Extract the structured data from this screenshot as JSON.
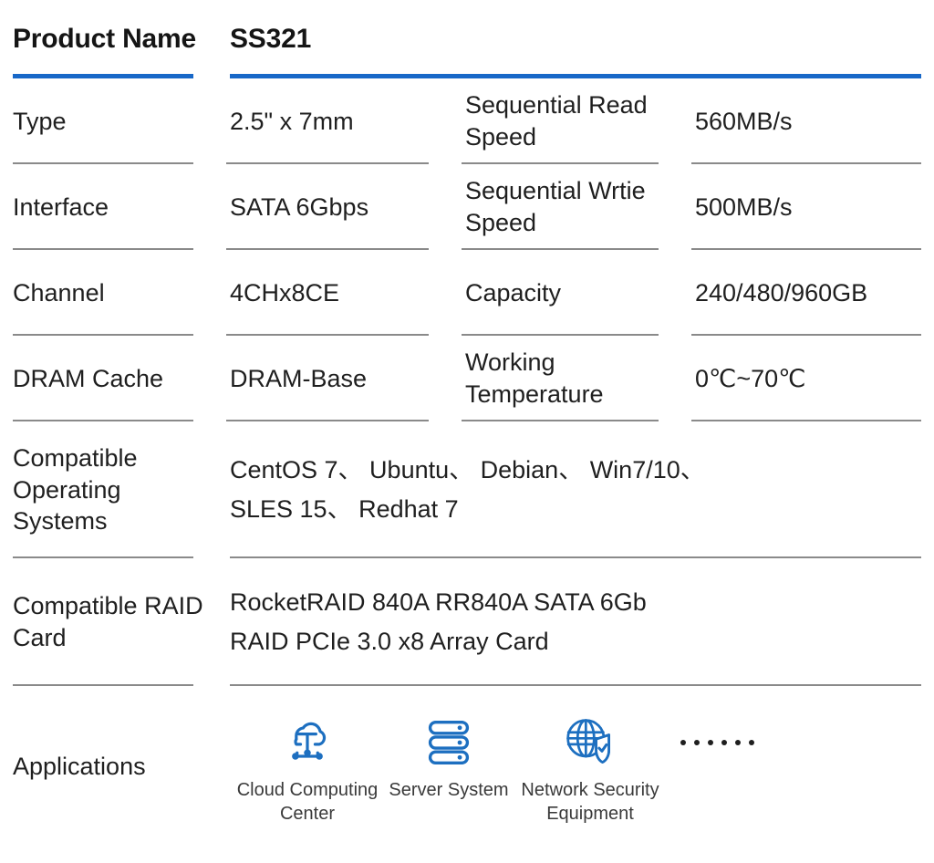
{
  "header": {
    "label": "Product Name",
    "value": "SS321",
    "accent_color": "#1868c8"
  },
  "rows": [
    {
      "label": "Type",
      "value": "2.5\" x 7mm",
      "label2": "Sequential Read Speed",
      "value2": "560MB/s"
    },
    {
      "label": "Interface",
      "value": "SATA 6Gbps",
      "label2": "Sequential Wrtie Speed",
      "value2": "500MB/s"
    },
    {
      "label": "Channel",
      "value": "4CHx8CE",
      "label2": "Capacity",
      "value2": "240/480/960GB"
    },
    {
      "label": "DRAM Cache",
      "value": "DRAM-Base",
      "label2": "Working Temperature",
      "value2": "0℃~70℃"
    }
  ],
  "wide_rows": [
    {
      "label": "Compatible Operating Systems",
      "lines": [
        "CentOS 7、 Ubuntu、 Debian、 Win7/10、",
        "SLES 15、 Redhat 7"
      ]
    },
    {
      "label": "Compatible RAID Card",
      "lines": [
        "RocketRAID 840A RR840A SATA 6Gb",
        "RAID PCIe 3.0 x8 Array Card"
      ]
    }
  ],
  "applications": {
    "label": "Applications",
    "items": [
      {
        "icon": "cloud-computing-icon",
        "caption": "Cloud Computing Center"
      },
      {
        "icon": "server-stack-icon",
        "caption": "Server System"
      },
      {
        "icon": "network-security-globe-shield-icon",
        "caption": "Network Security Equipment"
      }
    ],
    "more_indicator": "······",
    "icon_color": "#1d6fc0"
  }
}
